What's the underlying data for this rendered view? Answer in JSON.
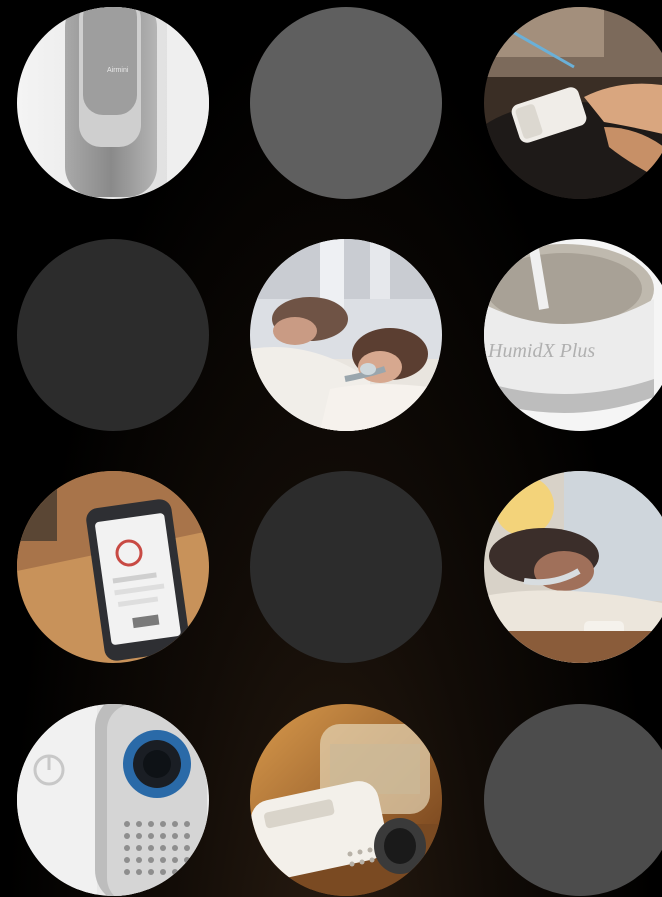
{
  "gallery": {
    "tiles": [
      {
        "name": "device-side-closeup",
        "kind": "photo",
        "text": "Airmini"
      },
      {
        "name": "placeholder-mid-gray",
        "kind": "placeholder",
        "color": "#5f5f5f"
      },
      {
        "name": "device-packing-bag",
        "kind": "photo",
        "text": ""
      },
      {
        "name": "placeholder-dark",
        "kind": "placeholder",
        "color": "#2c2c2c"
      },
      {
        "name": "couple-sleeping-mask",
        "kind": "photo",
        "text": ""
      },
      {
        "name": "humidx-plus-closeup",
        "kind": "photo",
        "text": "HumidX Plus"
      },
      {
        "name": "phone-app-on-table",
        "kind": "photo",
        "text": ""
      },
      {
        "name": "placeholder-dark-2",
        "kind": "placeholder",
        "color": "#2c2c2c"
      },
      {
        "name": "woman-sleeping-mask",
        "kind": "photo",
        "text": ""
      },
      {
        "name": "device-front-button",
        "kind": "photo",
        "text": ""
      },
      {
        "name": "device-on-nightstand",
        "kind": "photo",
        "text": ""
      },
      {
        "name": "placeholder-gray",
        "kind": "placeholder",
        "color": "#4c4c4c"
      }
    ]
  }
}
